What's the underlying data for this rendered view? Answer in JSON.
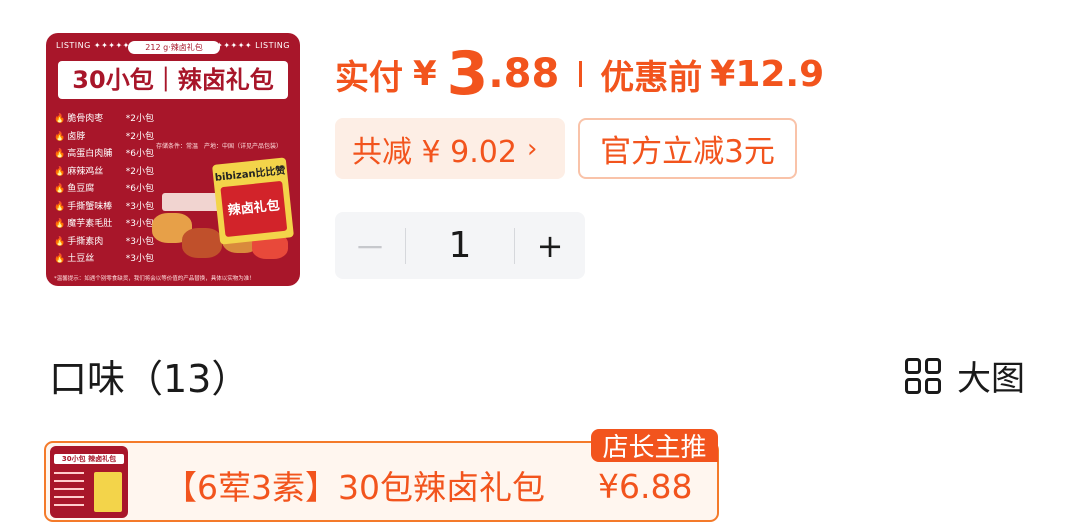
{
  "product_image": {
    "listing_left": "LISTING ✦✦✦✦✦",
    "listing_right": "✦✦✦✦✦ LISTING",
    "weight_tag": "212 g·辣卤礼包",
    "title": "30小包｜辣卤礼包",
    "items": [
      {
        "name": "脆骨肉枣",
        "qty": "*2小包"
      },
      {
        "name": "卤脖",
        "qty": "*2小包"
      },
      {
        "name": "高蛋白肉脯",
        "qty": "*6小包"
      },
      {
        "name": "麻辣鸡丝",
        "qty": "*2小包"
      },
      {
        "name": "鱼豆腐",
        "qty": "*6小包"
      },
      {
        "name": "手撕蟹味棒",
        "qty": "*3小包"
      },
      {
        "name": "魔芋素毛肚",
        "qty": "*3小包"
      },
      {
        "name": "手撕素肉",
        "qty": "*3小包"
      },
      {
        "name": "土豆丝",
        "qty": "*3小包"
      }
    ],
    "meta": "存储条件：常温　产地：中国（详见产品包装）",
    "package_brand": "bibizan比比赞",
    "package_label": "辣卤礼包",
    "footnote": "*温馨提示：如遇个别零食缺货，我们将会以等价值的产品替换，具体以实物为准！"
  },
  "price": {
    "pay_label": "实付",
    "currency": "¥",
    "pay_int": "3",
    "pay_dec": ".88",
    "orig_label": "优惠前",
    "orig_price": "¥12.9"
  },
  "discounts": {
    "total_save": "共减 ¥ 9.02",
    "official": "官方立减3元"
  },
  "stepper": {
    "minus": "－",
    "quantity": "1",
    "plus": "+"
  },
  "flavor": {
    "title": "口味（13）",
    "big_view": "大图"
  },
  "option": {
    "label": "【6荤3素】30包辣卤礼包",
    "price": "¥6.88",
    "badge": "店长主推",
    "mini_title": "30小包 辣卤礼包"
  },
  "colors": {
    "accent": "#f2541d",
    "product_red": "#a8162a"
  }
}
